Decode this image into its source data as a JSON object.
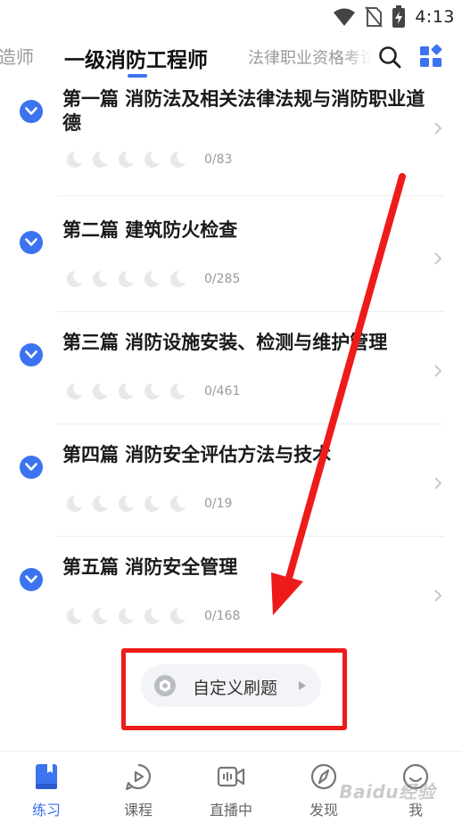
{
  "status_bar": {
    "time": "4:13"
  },
  "top_tabs": {
    "prev": "造师",
    "active": "一级消防工程师",
    "next": "法律职业资格考试"
  },
  "sections": [
    {
      "title": "第一篇 消防法及相关法律法规与消防职业道德",
      "count": "0/83"
    },
    {
      "title": "第二篇 建筑防火检查",
      "count": "0/285"
    },
    {
      "title": "第三篇 消防设施安装、检测与维护管理",
      "count": "0/461"
    },
    {
      "title": "第四篇 消防安全评估方法与技术",
      "count": "0/19"
    },
    {
      "title": "第五篇 消防安全管理",
      "count": "0/168"
    }
  ],
  "custom_practice": {
    "label": "自定义刷题"
  },
  "bottom_nav": [
    {
      "label": "练习",
      "icon": "practice-book-icon",
      "active": true
    },
    {
      "label": "课程",
      "icon": "course-play-icon",
      "active": false
    },
    {
      "label": "直播中",
      "icon": "live-camera-icon",
      "active": false
    },
    {
      "label": "发现",
      "icon": "discover-compass-icon",
      "active": false
    },
    {
      "label": "我",
      "icon": "profile-smile-icon",
      "active": false
    }
  ],
  "watermark": "Baidu经验",
  "colors": {
    "accent": "#3b73f0",
    "annotation_red": "#ee1b1b"
  }
}
